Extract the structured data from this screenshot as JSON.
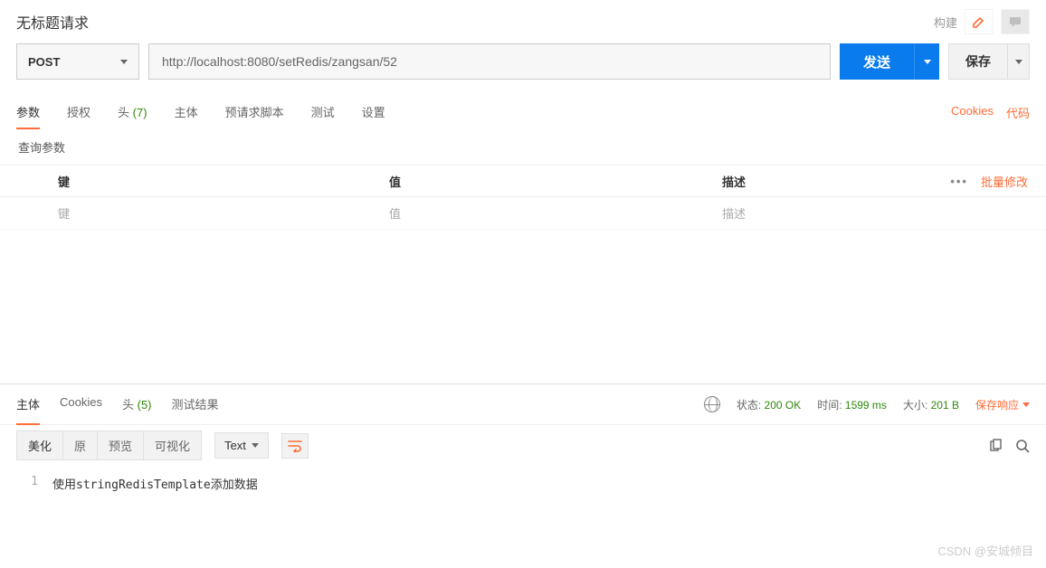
{
  "header": {
    "title": "无标题请求",
    "build": "构建"
  },
  "request": {
    "method": "POST",
    "url": "http://localhost:8080/setRedis/zangsan/52",
    "send": "发送",
    "save": "保存"
  },
  "tabs": {
    "items": [
      {
        "label": "参数",
        "active": true
      },
      {
        "label": "授权"
      },
      {
        "label": "头",
        "count": "(7)"
      },
      {
        "label": "主体"
      },
      {
        "label": "预请求脚本"
      },
      {
        "label": "测试"
      },
      {
        "label": "设置"
      }
    ],
    "links": [
      "Cookies",
      "代码"
    ]
  },
  "params": {
    "section_title": "查询参数",
    "headers": {
      "key": "键",
      "value": "值",
      "desc": "描述"
    },
    "placeholders": {
      "key": "键",
      "value": "值",
      "desc": "描述"
    },
    "bulk_edit": "批量修改"
  },
  "response": {
    "tabs": [
      {
        "label": "主体",
        "active": true
      },
      {
        "label": "Cookies"
      },
      {
        "label": "头",
        "count": "(5)"
      },
      {
        "label": "测试结果"
      }
    ],
    "status_label": "状态:",
    "status_value": "200 OK",
    "time_label": "时间:",
    "time_value": "1599 ms",
    "size_label": "大小:",
    "size_value": "201 B",
    "save": "保存响应",
    "view_modes": [
      "美化",
      "原",
      "预览",
      "可视化"
    ],
    "type": "Text",
    "line_no": "1",
    "content": "使用stringRedisTemplate添加数据"
  },
  "watermark": "CSDN @安城倾目"
}
